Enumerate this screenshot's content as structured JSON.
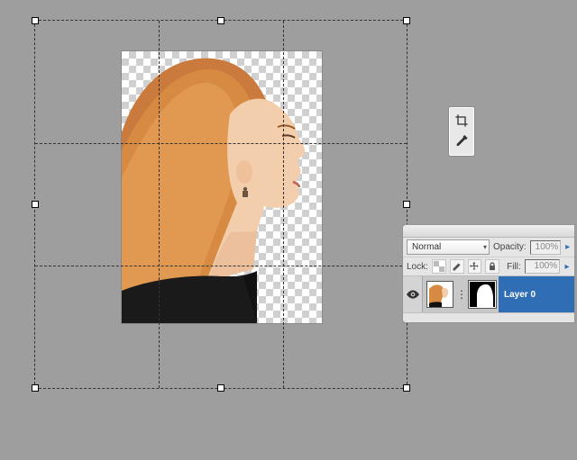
{
  "canvas": {
    "transparency_visible": true
  },
  "crop": {
    "guides": "rule-of-thirds",
    "handles": 8
  },
  "toolbox": {
    "tools": [
      {
        "name": "crop-tool-icon"
      },
      {
        "name": "eyedropper-tool-icon"
      }
    ]
  },
  "layers_panel": {
    "blend_mode": "Normal",
    "opacity_label": "Opacity:",
    "opacity_value": "100%",
    "lock_label": "Lock:",
    "fill_label": "Fill:",
    "fill_value": "100%",
    "layers": [
      {
        "visible": true,
        "has_mask": true,
        "linked": true,
        "name": "Layer 0",
        "selected": true
      }
    ]
  }
}
